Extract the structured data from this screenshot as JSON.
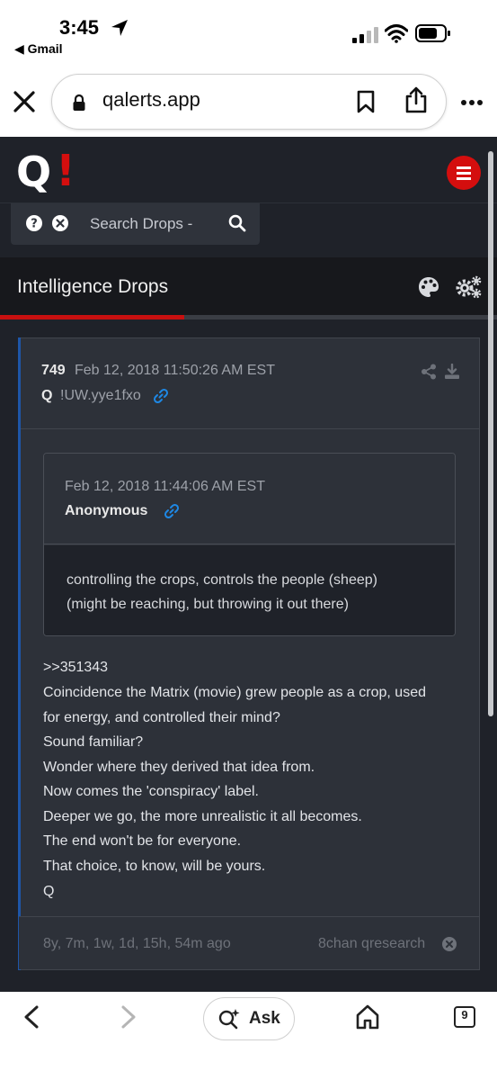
{
  "status_bar": {
    "time": "3:45",
    "back_app": "◀ Gmail"
  },
  "browser": {
    "url": "qalerts.app"
  },
  "site": {
    "logo_q": "Q",
    "logo_bang": "!",
    "search_placeholder": "Search Drops -",
    "section_title": "Intelligence Drops",
    "progress_percent": 37
  },
  "post": {
    "number": "749",
    "date": "Feb 12, 2018 11:50:26 AM EST",
    "author": "Q",
    "tripcode": "!UW.yye1fxo",
    "quoted": {
      "date": "Feb 12, 2018 11:44:06 AM EST",
      "author": "Anonymous",
      "lines": [
        "controlling the crops, controls the people (sheep)",
        "(might be reaching, but throwing it out there)"
      ]
    },
    "message_lines": [
      ">>351343",
      "Coincidence the Matrix (movie) grew people as a crop, used",
      "for energy, and controlled their mind?",
      "Sound familiar?",
      "Wonder where they derived that idea from.",
      "Now comes the 'conspiracy' label.",
      "Deeper we go, the more unrealistic it all becomes.",
      "The end won't be for everyone.",
      "That choice, to know, will be yours.",
      "Q"
    ],
    "age": "8y, 7m, 1w, 1d, 15h, 54m ago",
    "source": "8chan qresearch"
  },
  "toolbar": {
    "ask_label": "Ask",
    "tabs_count": "9"
  },
  "colors": {
    "accent_red": "#d40e0e",
    "link_blue": "#1e88e5",
    "background": "#1f2229"
  },
  "icons": [
    "location-arrow-icon",
    "signal-icon",
    "wifi-icon",
    "battery-icon",
    "close-icon",
    "lock-icon",
    "bookmark-icon",
    "share-icon",
    "more-icon",
    "menu-icon",
    "help-icon",
    "clear-icon",
    "search-icon",
    "palette-icon",
    "gears-icon",
    "link-icon",
    "download-icon",
    "back-icon",
    "forward-icon",
    "ask-icon",
    "home-icon"
  ]
}
